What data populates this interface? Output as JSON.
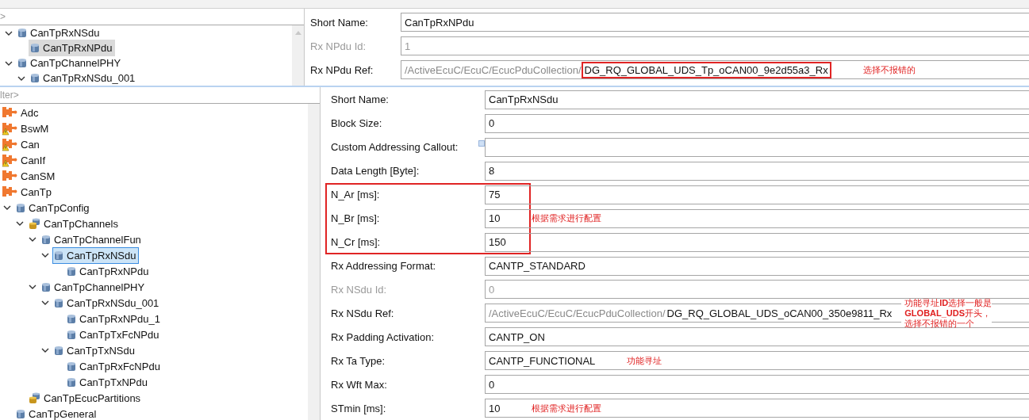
{
  "top_panel": {
    "filter": {
      "placeholder": ">"
    },
    "tree": [
      {
        "children": [
          {
            "label": "CanTpRxNSdu",
            "kind": "container",
            "expanded": true,
            "selected": false,
            "children": [
              {
                "label": "CanTpRxNPdu",
                "kind": "container",
                "selected": true
              }
            ]
          }
        ]
      },
      {
        "label": "CanTpChannelPHY",
        "kind": "container",
        "expanded": true,
        "selected": false,
        "children": [
          {
            "label": "CanTpRxNSdu_001",
            "kind": "container",
            "expanded": true,
            "selected": false
          }
        ]
      }
    ],
    "fields": [
      {
        "kind": "text",
        "label": "Short Name:",
        "value": "CanTpRxNPdu",
        "disabled": false
      },
      {
        "kind": "text",
        "label": "Rx NPdu Id:",
        "value": "1",
        "disabled": true
      },
      {
        "kind": "reference",
        "label": "Rx NPdu Ref:",
        "path": "/ActiveEcuC/EcuC/EcucPduCollection/",
        "value": "DG_RQ_GLOBAL_UDS_Tp_oCAN00_9e2d55a3_Rx",
        "disabled": false,
        "highlighted": true,
        "annotation": [
          "选择不报错的"
        ]
      }
    ]
  },
  "bottom_panel": {
    "filter": {
      "placeholder": "lter>"
    },
    "tree": [
      {
        "label": "Adc",
        "kind": "module",
        "warning": false,
        "selected": false
      },
      {
        "label": "BswM",
        "kind": "module",
        "warning": true,
        "selected": false
      },
      {
        "label": "Can",
        "kind": "module",
        "warning": true,
        "selected": false
      },
      {
        "label": "CanIf",
        "kind": "module",
        "warning": true,
        "selected": false
      },
      {
        "label": "CanSM",
        "kind": "module",
        "warning": false,
        "selected": false
      },
      {
        "label": "CanTp",
        "kind": "module",
        "warning": false,
        "selected": false,
        "children": [
          {
            "label": "CanTpConfig",
            "kind": "container",
            "expanded": true,
            "selected": false,
            "children": [
              {
                "label": "CanTpChannels",
                "kind": "container_list",
                "expanded": true,
                "selected": false,
                "children": [
                  {
                    "label": "CanTpChannelFun",
                    "kind": "container",
                    "expanded": true,
                    "selected": false,
                    "children": [
                      {
                        "label": "CanTpRxNSdu",
                        "kind": "container",
                        "expanded": true,
                        "selected": true,
                        "children": [
                          {
                            "label": "CanTpRxNPdu",
                            "kind": "container",
                            "selected": false
                          }
                        ]
                      }
                    ]
                  },
                  {
                    "label": "CanTpChannelPHY",
                    "kind": "container",
                    "expanded": true,
                    "selected": false,
                    "children": [
                      {
                        "label": "CanTpRxNSdu_001",
                        "kind": "container",
                        "expanded": true,
                        "selected": false,
                        "children": [
                          {
                            "label": "CanTpRxNPdu_1",
                            "kind": "container",
                            "selected": false
                          },
                          {
                            "label": "CanTpTxFcNPdu",
                            "kind": "container",
                            "selected": false
                          }
                        ]
                      },
                      {
                        "label": "CanTpTxNSdu",
                        "kind": "container",
                        "expanded": true,
                        "selected": false,
                        "children": [
                          {
                            "label": "CanTpRxFcNPdu",
                            "kind": "container",
                            "selected": false
                          },
                          {
                            "label": "CanTpTxNPdu",
                            "kind": "container",
                            "selected": false
                          }
                        ]
                      }
                    ]
                  }
                ]
              },
              {
                "label": "CanTpEcucPartitions",
                "kind": "container_list",
                "selected": false
              }
            ]
          },
          {
            "label": "CanTpGeneral",
            "kind": "container",
            "selected": false
          }
        ]
      }
    ],
    "fields": [
      {
        "kind": "text",
        "label": "Short Name:",
        "value": "CanTpRxNSdu",
        "disabled": false
      },
      {
        "kind": "text",
        "label": "Block Size:",
        "value": "0",
        "disabled": false
      },
      {
        "kind": "callout",
        "label": "Custom Addressing Callout:",
        "disabled": false
      },
      {
        "kind": "text",
        "label": "Data Length [Byte]:",
        "value": "8",
        "disabled": false
      },
      {
        "kind": "text",
        "label": "N_Ar [ms]:",
        "value": "75",
        "disabled": false,
        "highlighted": true
      },
      {
        "kind": "text",
        "label": "N_Br [ms]:",
        "value": "10",
        "disabled": false,
        "highlighted": true,
        "annotation": [
          "根据需求进行配置"
        ]
      },
      {
        "kind": "text",
        "label": "N_Cr [ms]:",
        "value": "150",
        "disabled": false,
        "highlighted": true
      },
      {
        "kind": "text",
        "label": "Rx Addressing Format:",
        "value": "CANTP_STANDARD",
        "disabled": false
      },
      {
        "kind": "text",
        "label": "Rx NSdu Id:",
        "value": "0",
        "disabled": true
      },
      {
        "kind": "reference",
        "label": "Rx NSdu Ref:",
        "path": "/ActiveEcuC/EcuC/EcucPduCollection/",
        "value": "DG_RQ_GLOBAL_UDS_oCAN00_350e9811_Rx",
        "disabled": false,
        "annotation": [
          "功能寻址**ID**选择一般是",
          "**GLOBAL_UDS**开头，",
          "选择不报错的一个"
        ]
      },
      {
        "kind": "text",
        "label": "Rx Padding Activation:",
        "value": "CANTP_ON",
        "disabled": false
      },
      {
        "kind": "text",
        "label": "Rx Ta Type:",
        "value": "CANTP_FUNCTIONAL",
        "disabled": false,
        "annotation": [
          "功能寻址"
        ]
      },
      {
        "kind": "text",
        "label": "Rx Wft Max:",
        "value": "0",
        "disabled": false
      },
      {
        "kind": "text",
        "label": "STmin [ms]:",
        "value": "10",
        "disabled": false,
        "annotation": [
          "根据需求进行配置"
        ]
      }
    ]
  }
}
